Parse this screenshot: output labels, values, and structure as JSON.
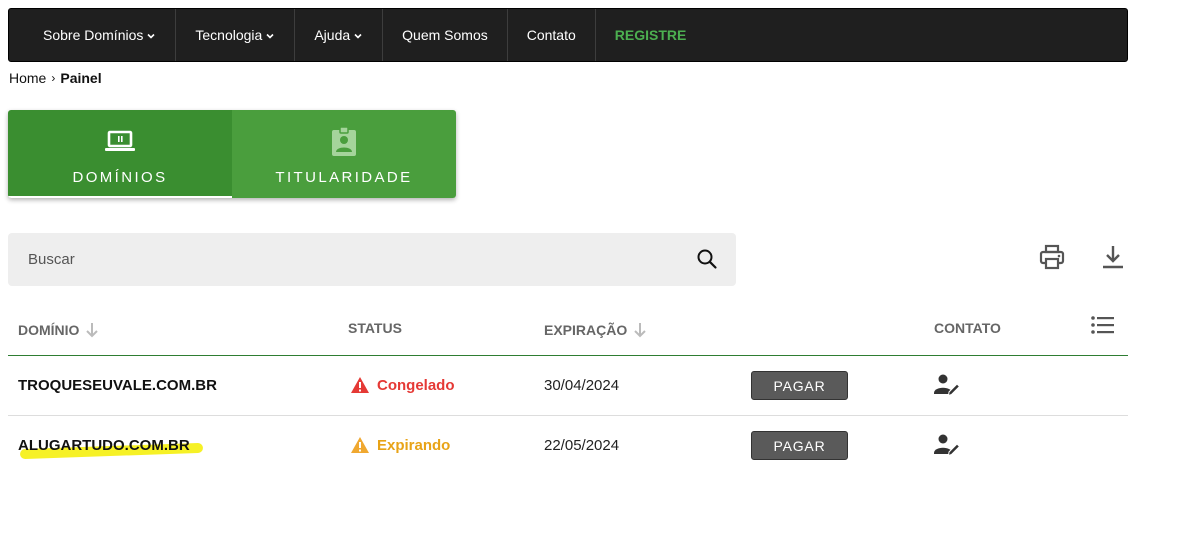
{
  "nav": {
    "items": [
      {
        "label": "Sobre Domínios",
        "dropdown": true
      },
      {
        "label": "Tecnologia",
        "dropdown": true
      },
      {
        "label": "Ajuda",
        "dropdown": true
      },
      {
        "label": "Quem Somos",
        "dropdown": false
      },
      {
        "label": "Contato",
        "dropdown": false
      }
    ],
    "register_label": "REGISTRE"
  },
  "breadcrumb": {
    "home": "Home",
    "separator": "›",
    "current": "Painel"
  },
  "tabs": [
    {
      "label": "DOMÍNIOS",
      "icon": "laptop-icon",
      "active": true
    },
    {
      "label": "TITULARIDADE",
      "icon": "badge-icon",
      "active": false
    }
  ],
  "search": {
    "placeholder": "Buscar",
    "value": ""
  },
  "toolbar": {
    "print_icon": "print-icon",
    "download_icon": "download-icon"
  },
  "table": {
    "columns": {
      "domain": "DOMÍNIO",
      "status": "STATUS",
      "expiry": "EXPIRAÇÃO",
      "contact": "CONTATO"
    },
    "rows": [
      {
        "domain": "TROQUESEUVALE.COM.BR",
        "status": "Congelado",
        "status_color": "#e53935",
        "expiry": "30/04/2024",
        "action": "PAGAR",
        "highlighted": false
      },
      {
        "domain": "ALUGARTUDO.COM.BR",
        "status": "Expirando",
        "status_color": "#e8a317",
        "expiry": "22/05/2024",
        "action": "PAGAR",
        "highlighted": true
      }
    ]
  },
  "colors": {
    "nav_bg": "#1f1f1f",
    "accent_green": "#4caf50",
    "tab_active": "#3a8e30",
    "tab_inactive": "#4a9e3d",
    "highlight": "#f4ee00"
  }
}
